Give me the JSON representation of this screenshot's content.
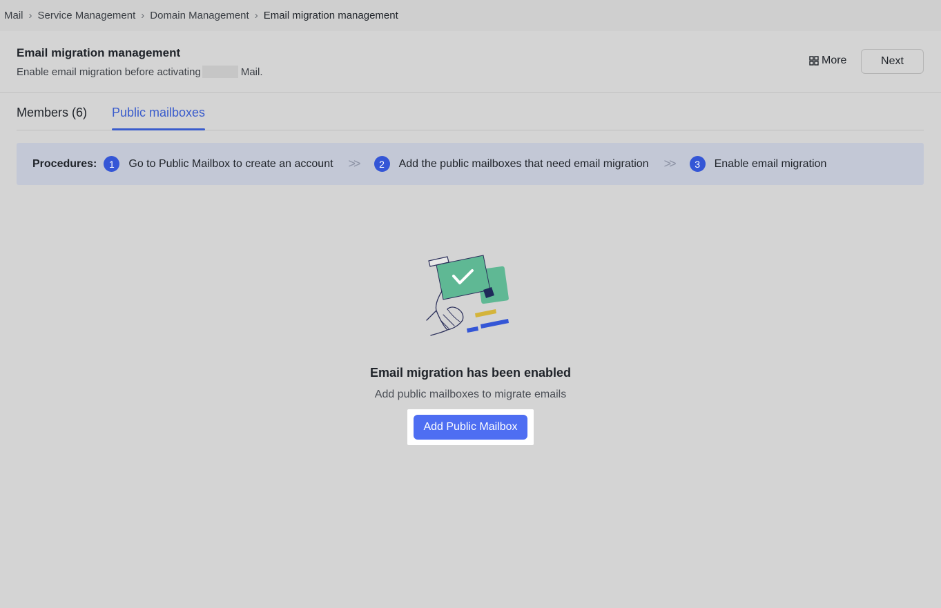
{
  "breadcrumb": {
    "items": [
      "Mail",
      "Service Management",
      "Domain Management",
      "Email migration management"
    ]
  },
  "header": {
    "title": "Email migration management",
    "subtitle_before": "Enable email migration before activating",
    "subtitle_after": "Mail.",
    "more_label": "More",
    "next_label": "Next"
  },
  "tabs": [
    {
      "label": "Members (6)",
      "active": false
    },
    {
      "label": "Public mailboxes",
      "active": true
    }
  ],
  "procedures": {
    "label": "Procedures:",
    "steps": [
      {
        "num": "1",
        "text": "Go to Public Mailbox to create an account"
      },
      {
        "num": "2",
        "text": "Add the public mailboxes that need email migration"
      },
      {
        "num": "3",
        "text": "Enable email migration"
      }
    ],
    "separator": "»"
  },
  "empty_state": {
    "illustration": "checkmark-card-icon",
    "title": "Email migration has been enabled",
    "description": "Add public mailboxes to migrate emails",
    "button_label": "Add Public Mailbox"
  },
  "colors": {
    "accent": "#3a5ccc",
    "primary_button": "#4e6ef2",
    "illustration_green": "#5fb894",
    "illustration_yellow": "#d4b43a"
  }
}
